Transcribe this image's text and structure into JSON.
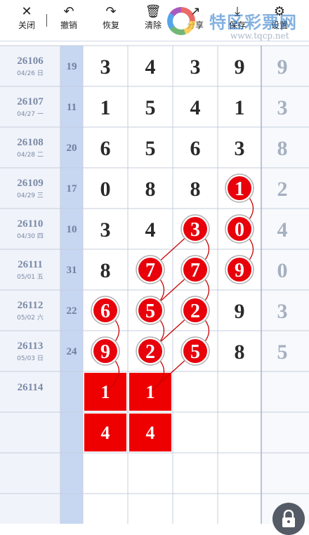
{
  "toolbar": {
    "buttons": [
      {
        "id": "close",
        "label": "关闭",
        "icon": "close-icon"
      },
      {
        "id": "undo",
        "label": "撤销",
        "icon": "undo-icon"
      },
      {
        "id": "redo",
        "label": "恢复",
        "icon": "redo-icon"
      },
      {
        "id": "clear",
        "label": "清除",
        "icon": "trash-icon"
      },
      {
        "id": "share",
        "label": "分享",
        "icon": "share-icon"
      },
      {
        "id": "save",
        "label": "保存",
        "icon": "download-icon"
      },
      {
        "id": "settings",
        "label": "设置",
        "icon": "gear-icon"
      }
    ]
  },
  "watermark": {
    "text": "特区彩票网",
    "url": "www.tqcp.net"
  },
  "rows": [
    {
      "period": "26106",
      "date": "04/26 日",
      "sum": "19",
      "digits": [
        "3",
        "4",
        "3",
        "9"
      ],
      "extra": "9"
    },
    {
      "period": "26107",
      "date": "04/27 一",
      "sum": "11",
      "digits": [
        "1",
        "5",
        "4",
        "1"
      ],
      "extra": "3"
    },
    {
      "period": "26108",
      "date": "04/28 二",
      "sum": "20",
      "digits": [
        "6",
        "5",
        "6",
        "3"
      ],
      "extra": "8"
    },
    {
      "period": "26109",
      "date": "04/29 三",
      "sum": "17",
      "digits": [
        "0",
        "8",
        "8",
        "1"
      ],
      "extra": "2"
    },
    {
      "period": "26110",
      "date": "04/30 四",
      "sum": "10",
      "digits": [
        "3",
        "4",
        "3",
        "0"
      ],
      "extra": "4"
    },
    {
      "period": "26111",
      "date": "05/01 五",
      "sum": "31",
      "digits": [
        "8",
        "7",
        "7",
        "9"
      ],
      "extra": "0"
    },
    {
      "period": "26112",
      "date": "05/02 六",
      "sum": "22",
      "digits": [
        "6",
        "5",
        "2",
        "9"
      ],
      "extra": "3"
    },
    {
      "period": "26113",
      "date": "05/03 日",
      "sum": "24",
      "digits": [
        "9",
        "2",
        "5",
        "8"
      ],
      "extra": "5"
    },
    {
      "period": "26114",
      "date": "",
      "sum": "",
      "digits": [
        "1",
        "1",
        "",
        ""
      ],
      "extra": ""
    },
    {
      "period": "",
      "date": "",
      "sum": "",
      "digits": [
        "4",
        "4",
        "",
        ""
      ],
      "extra": ""
    },
    {
      "period": "",
      "date": "",
      "sum": "",
      "digits": [
        "",
        "",
        "",
        ""
      ],
      "extra": ""
    },
    {
      "period": "",
      "date": "",
      "sum": "",
      "digits": [
        "",
        "",
        "",
        ""
      ],
      "extra": ""
    }
  ],
  "balls": [
    {
      "row": 3,
      "col": 3
    },
    {
      "row": 4,
      "col": 3
    },
    {
      "row": 5,
      "col": 3
    },
    {
      "row": 4,
      "col": 2
    },
    {
      "row": 5,
      "col": 2
    },
    {
      "row": 6,
      "col": 2
    },
    {
      "row": 7,
      "col": 2
    },
    {
      "row": 5,
      "col": 1
    },
    {
      "row": 6,
      "col": 1
    },
    {
      "row": 7,
      "col": 1
    },
    {
      "row": 6,
      "col": 0
    },
    {
      "row": 7,
      "col": 0
    }
  ],
  "links": [
    [
      [
        3,
        3
      ],
      [
        4,
        3
      ]
    ],
    [
      [
        4,
        3
      ],
      [
        5,
        3
      ]
    ],
    [
      [
        4,
        2
      ],
      [
        5,
        1
      ]
    ],
    [
      [
        5,
        2
      ],
      [
        6,
        1
      ]
    ],
    [
      [
        6,
        2
      ],
      [
        7,
        1
      ]
    ],
    [
      [
        4,
        2
      ],
      [
        5,
        2
      ]
    ],
    [
      [
        5,
        2
      ],
      [
        6,
        2
      ]
    ],
    [
      [
        6,
        2
      ],
      [
        7,
        2
      ]
    ],
    [
      [
        5,
        1
      ],
      [
        6,
        1
      ]
    ],
    [
      [
        6,
        1
      ],
      [
        7,
        1
      ]
    ],
    [
      [
        6,
        0
      ],
      [
        7,
        0
      ]
    ],
    [
      [
        7,
        0
      ],
      [
        8,
        0
      ]
    ],
    [
      [
        7,
        1
      ],
      [
        8,
        1
      ]
    ],
    [
      [
        7,
        2
      ],
      [
        8,
        1
      ]
    ]
  ],
  "squares": [
    {
      "row": 8,
      "col": 0
    },
    {
      "row": 8,
      "col": 1
    },
    {
      "row": 9,
      "col": 0
    },
    {
      "row": 9,
      "col": 1
    }
  ],
  "colors": {
    "ball": "#e8000b",
    "square": "#ef0000",
    "sum_column": "#c7d7f2",
    "label_bg": "#f0f3f9",
    "line": "#c80000"
  }
}
